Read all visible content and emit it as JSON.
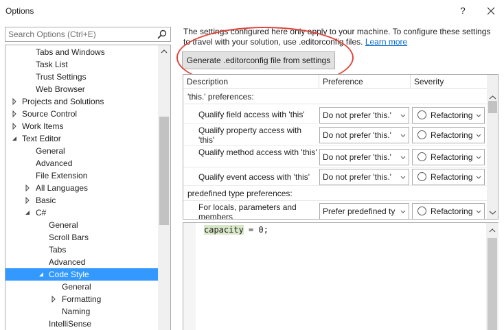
{
  "window": {
    "title": "Options",
    "help_label": "?"
  },
  "search": {
    "placeholder": "Search Options (Ctrl+E)"
  },
  "tree": {
    "items": [
      {
        "label": "Tabs and Windows"
      },
      {
        "label": "Task List"
      },
      {
        "label": "Trust Settings"
      },
      {
        "label": "Web Browser"
      },
      {
        "label": "Projects and Solutions"
      },
      {
        "label": "Source Control"
      },
      {
        "label": "Work Items"
      },
      {
        "label": "Text Editor"
      },
      {
        "label": "General"
      },
      {
        "label": "Advanced"
      },
      {
        "label": "File Extension"
      },
      {
        "label": "All Languages"
      },
      {
        "label": "Basic"
      },
      {
        "label": "C#"
      },
      {
        "label": "General"
      },
      {
        "label": "Scroll Bars"
      },
      {
        "label": "Tabs"
      },
      {
        "label": "Advanced"
      },
      {
        "label": "Code Style"
      },
      {
        "label": "General"
      },
      {
        "label": "Formatting"
      },
      {
        "label": "Naming"
      },
      {
        "label": "IntelliSense"
      }
    ]
  },
  "info": {
    "text": "The settings configured here only apply to your machine. To configure these settings to travel with your solution, use .editorconfig files.",
    "link": "Learn more"
  },
  "generate_button": "Generate .editorconfig file from settings",
  "grid": {
    "columns": [
      "Description",
      "Preference",
      "Severity"
    ],
    "sections": [
      {
        "title": "'this.' preferences:"
      },
      {
        "title": "predefined type preferences:"
      }
    ],
    "rows": [
      {
        "desc": "Qualify field access with 'this'",
        "pref": "Do not prefer 'this.'",
        "sev": "Refactoring"
      },
      {
        "desc": "Qualify property access with 'this'",
        "pref": "Do not prefer 'this.'",
        "sev": "Refactoring"
      },
      {
        "desc": "Qualify method access with 'this'",
        "pref": "Do not prefer 'this.'",
        "sev": "Refactoring"
      },
      {
        "desc": "Qualify event access with 'this'",
        "pref": "Do not prefer 'this.'",
        "sev": "Refactoring"
      },
      {
        "desc": "For locals, parameters and members",
        "pref": "Prefer predefined ty",
        "sev": "Refactoring"
      }
    ]
  },
  "editor": {
    "code_highlight": "capacity",
    "code_rest": " = 0;"
  },
  "colors": {
    "selection": "#3399ff",
    "annotation_ellipse": "#e0453a",
    "link": "#0066cc"
  }
}
